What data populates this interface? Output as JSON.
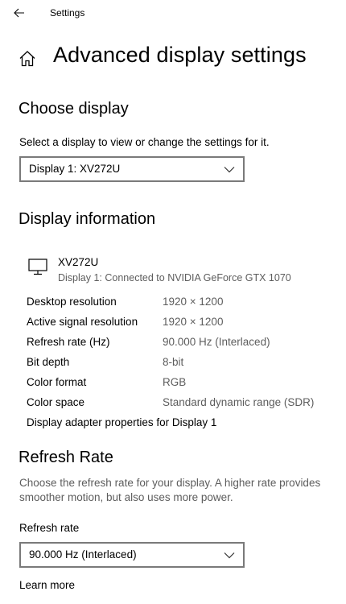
{
  "window": {
    "title": "Settings"
  },
  "header": {
    "title": "Advanced display settings"
  },
  "choose_display": {
    "heading": "Choose display",
    "description": "Select a display to view or change the settings for it.",
    "selected": "Display 1: XV272U"
  },
  "display_information": {
    "heading": "Display information",
    "monitor_name": "XV272U",
    "monitor_connection": "Display 1: Connected to NVIDIA GeForce GTX 1070",
    "rows": [
      {
        "label": "Desktop resolution",
        "value": "1920 × 1200"
      },
      {
        "label": "Active signal resolution",
        "value": "1920 × 1200"
      },
      {
        "label": "Refresh rate (Hz)",
        "value": "90.000 Hz (Interlaced)"
      },
      {
        "label": "Bit depth",
        "value": "8-bit"
      },
      {
        "label": "Color format",
        "value": "RGB"
      },
      {
        "label": "Color space",
        "value": "Standard dynamic range (SDR)"
      }
    ],
    "adapter_link": "Display adapter properties for Display 1"
  },
  "refresh_rate": {
    "heading": "Refresh Rate",
    "description": "Choose the refresh rate for your display. A higher rate provides smoother motion, but also uses more power.",
    "field_label": "Refresh rate",
    "selected": "90.000 Hz (Interlaced)",
    "learn_more": "Learn more"
  },
  "icons": {
    "back": "back-arrow-icon",
    "home": "home-icon",
    "monitor": "monitor-icon",
    "chevron": "chevron-down-icon"
  }
}
